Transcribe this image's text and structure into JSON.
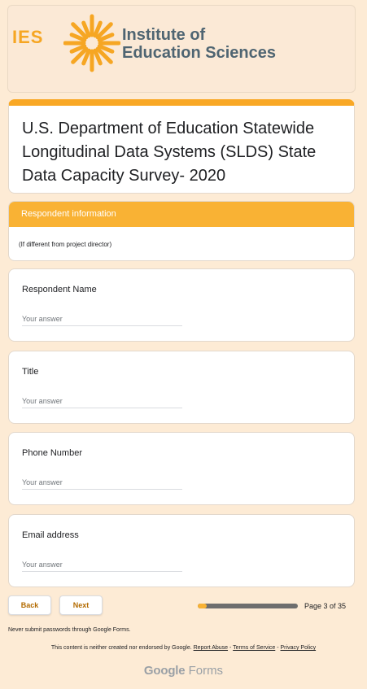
{
  "header": {
    "logo_acronym": "IES",
    "org_line1": "Institute of",
    "org_line2": "Education Sciences"
  },
  "form": {
    "title": "U.S. Department of Education Statewide Longitudinal Data Systems (SLDS) State Data Capacity Survey- 2020"
  },
  "section": {
    "title": "Respondent information",
    "description": "(If different from project director)"
  },
  "questions": [
    {
      "label": "Respondent Name",
      "placeholder": "Your answer",
      "value": ""
    },
    {
      "label": "Title",
      "placeholder": "Your answer",
      "value": ""
    },
    {
      "label": "Phone Number",
      "placeholder": "Your answer",
      "value": ""
    },
    {
      "label": "Email address",
      "placeholder": "Your answer",
      "value": ""
    }
  ],
  "navigation": {
    "back_label": "Back",
    "next_label": "Next",
    "page_text": "Page 3 of 35",
    "current_page": 3,
    "total_pages": 35
  },
  "footer": {
    "password_warning": "Never submit passwords through Google Forms.",
    "disclaimer_text": "This content is neither created nor endorsed by Google.",
    "report_abuse": "Report Abuse",
    "sep1": " - ",
    "terms": "Terms of Service",
    "sep2": " - ",
    "privacy": "Privacy Policy",
    "brand_google": "Google",
    "brand_forms": "Forms"
  },
  "colors": {
    "page_background": "#fdebd5",
    "accent": "#f9b234",
    "logo_orange": "#f6a623",
    "logo_slate": "#4f6572",
    "button_text": "#b36b00"
  },
  "icons": {
    "logo_mark": "sunburst-icon"
  }
}
